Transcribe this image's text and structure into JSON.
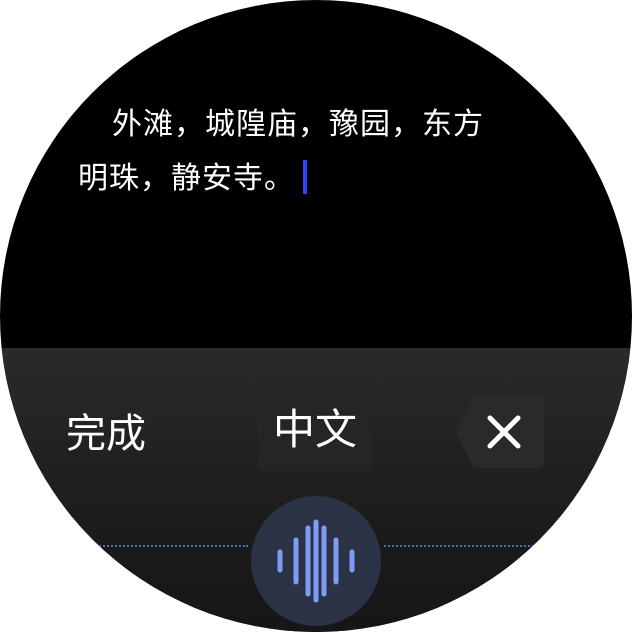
{
  "input": {
    "line1": "外滩，城隍庙，豫园，东方",
    "line2": "明珠，静安寺。"
  },
  "ime": {
    "done_label": "完成",
    "language_label": "中文",
    "delete_icon": "close-icon",
    "voice_icon": "voice-wave-icon"
  },
  "colors": {
    "cursor": "#2a46ff",
    "voice_button_bg": "#2b3246",
    "wave_bar": "#7f9cf5",
    "dotted_line": "#4a6cc2"
  }
}
